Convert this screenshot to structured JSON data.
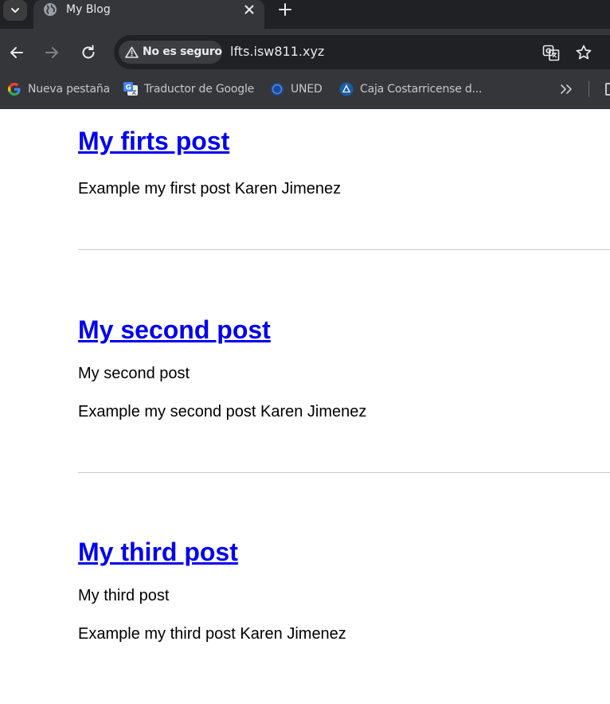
{
  "browser": {
    "tab": {
      "title": "My Blog",
      "icon": "globe-icon"
    },
    "omnibox": {
      "security_label": "No es seguro",
      "url": "lfts.isw811.xyz"
    },
    "bookmarks": [
      {
        "label": "Nueva pestaña",
        "icon": "google-icon"
      },
      {
        "label": "Traductor de Google",
        "icon": "google-translate-icon"
      },
      {
        "label": "UNED",
        "icon": "uned-icon"
      },
      {
        "label": "Caja Costarricense d...",
        "icon": "ccss-icon"
      }
    ],
    "colors": {
      "tabstrip": "#202124",
      "toolbar": "#35363a",
      "omnibox": "#202124",
      "link": "#0000ee"
    }
  },
  "page": {
    "posts": [
      {
        "title": "My firts post",
        "body": [
          "Example my first post Karen Jimenez"
        ]
      },
      {
        "title": "My second post",
        "body": [
          "My second post",
          "Example my second post Karen Jimenez"
        ]
      },
      {
        "title": "My third post",
        "body": [
          "My third post",
          "Example my third post Karen Jimenez"
        ]
      }
    ]
  }
}
